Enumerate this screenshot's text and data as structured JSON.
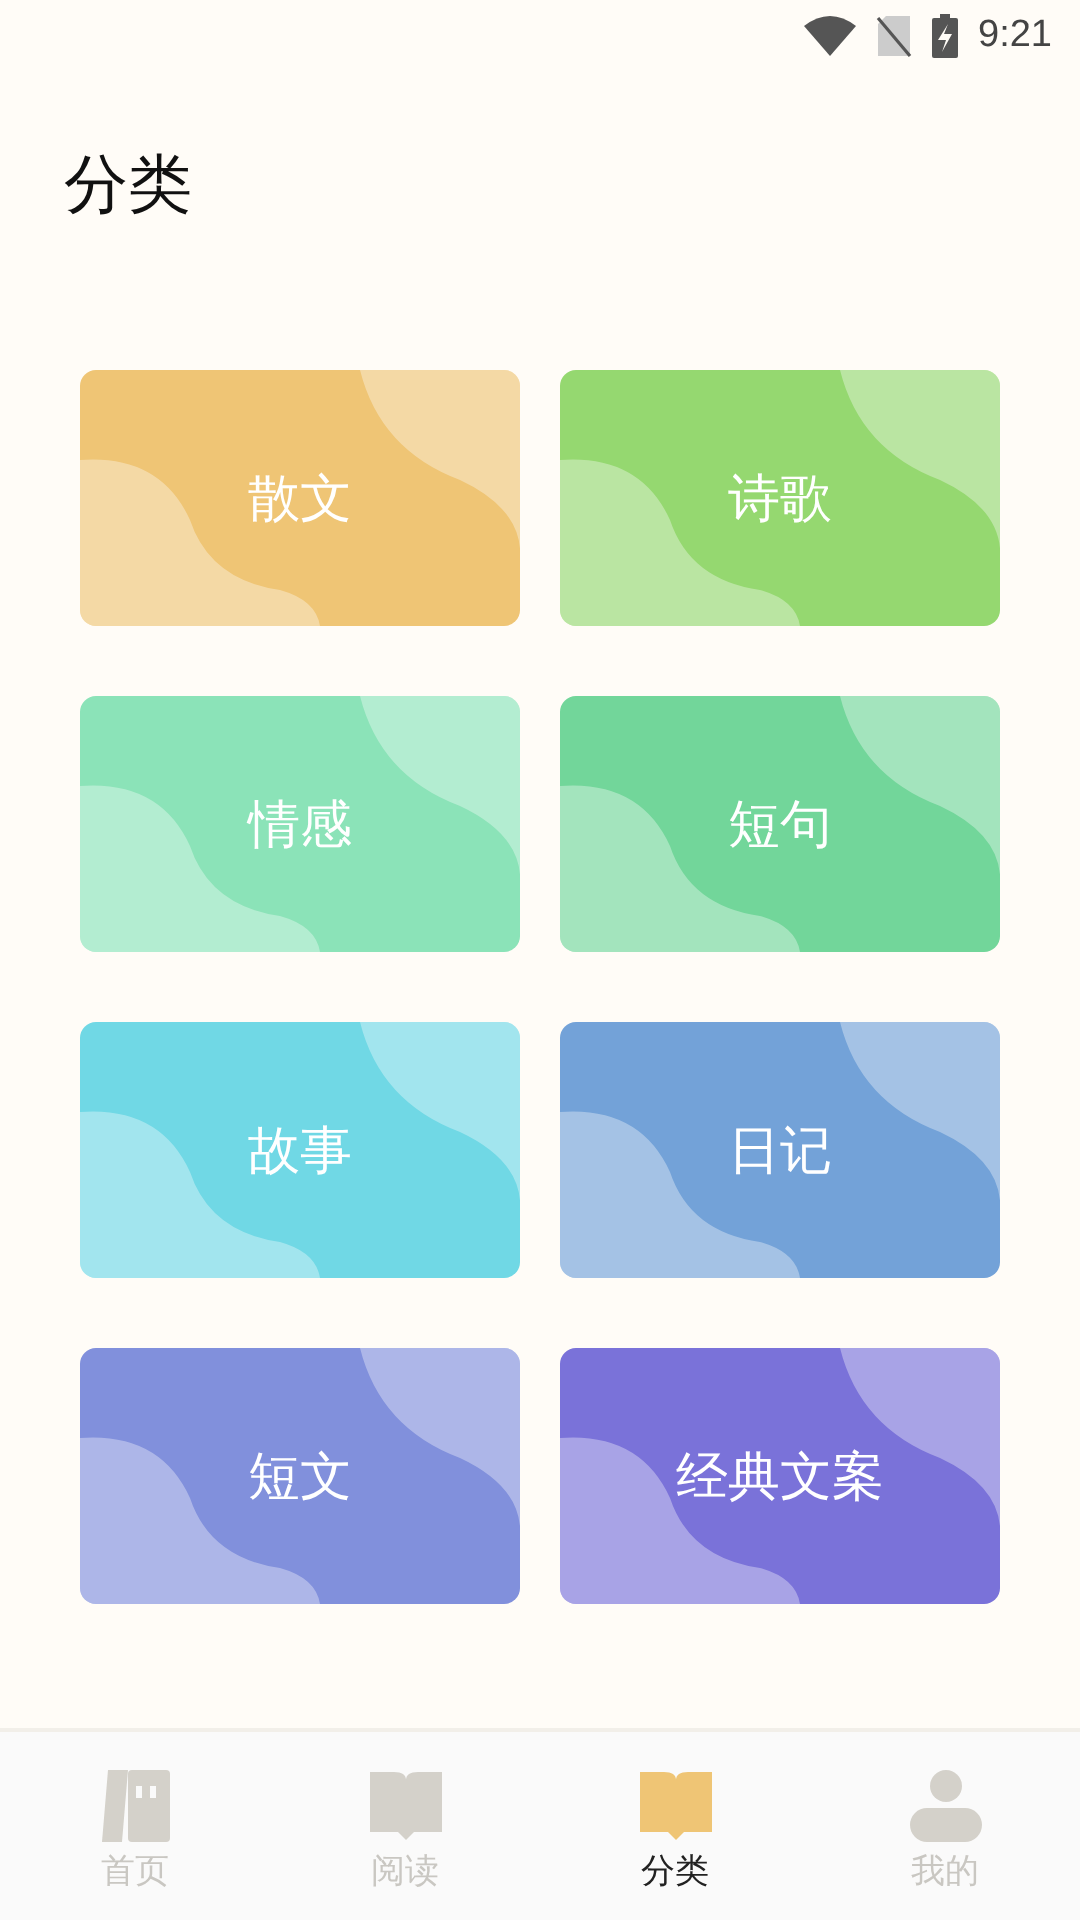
{
  "status_bar": {
    "time": "9:21"
  },
  "title": "分类",
  "categories": [
    {
      "label": "散文",
      "color": "#efc575"
    },
    {
      "label": "诗歌",
      "color": "#95d870"
    },
    {
      "label": "情感",
      "color": "#8be3b8"
    },
    {
      "label": "短句",
      "color": "#72d69a"
    },
    {
      "label": "故事",
      "color": "#70d8e5"
    },
    {
      "label": "日记",
      "color": "#73a2d8"
    },
    {
      "label": "短文",
      "color": "#8190dc"
    },
    {
      "label": "经典文案",
      "color": "#7a72d9"
    }
  ],
  "tabs": [
    {
      "label": "首页",
      "kind": "home",
      "selected": false
    },
    {
      "label": "阅读",
      "kind": "read",
      "selected": false
    },
    {
      "label": "分类",
      "kind": "category",
      "selected": true
    },
    {
      "label": "我的",
      "kind": "profile",
      "selected": false
    }
  ]
}
